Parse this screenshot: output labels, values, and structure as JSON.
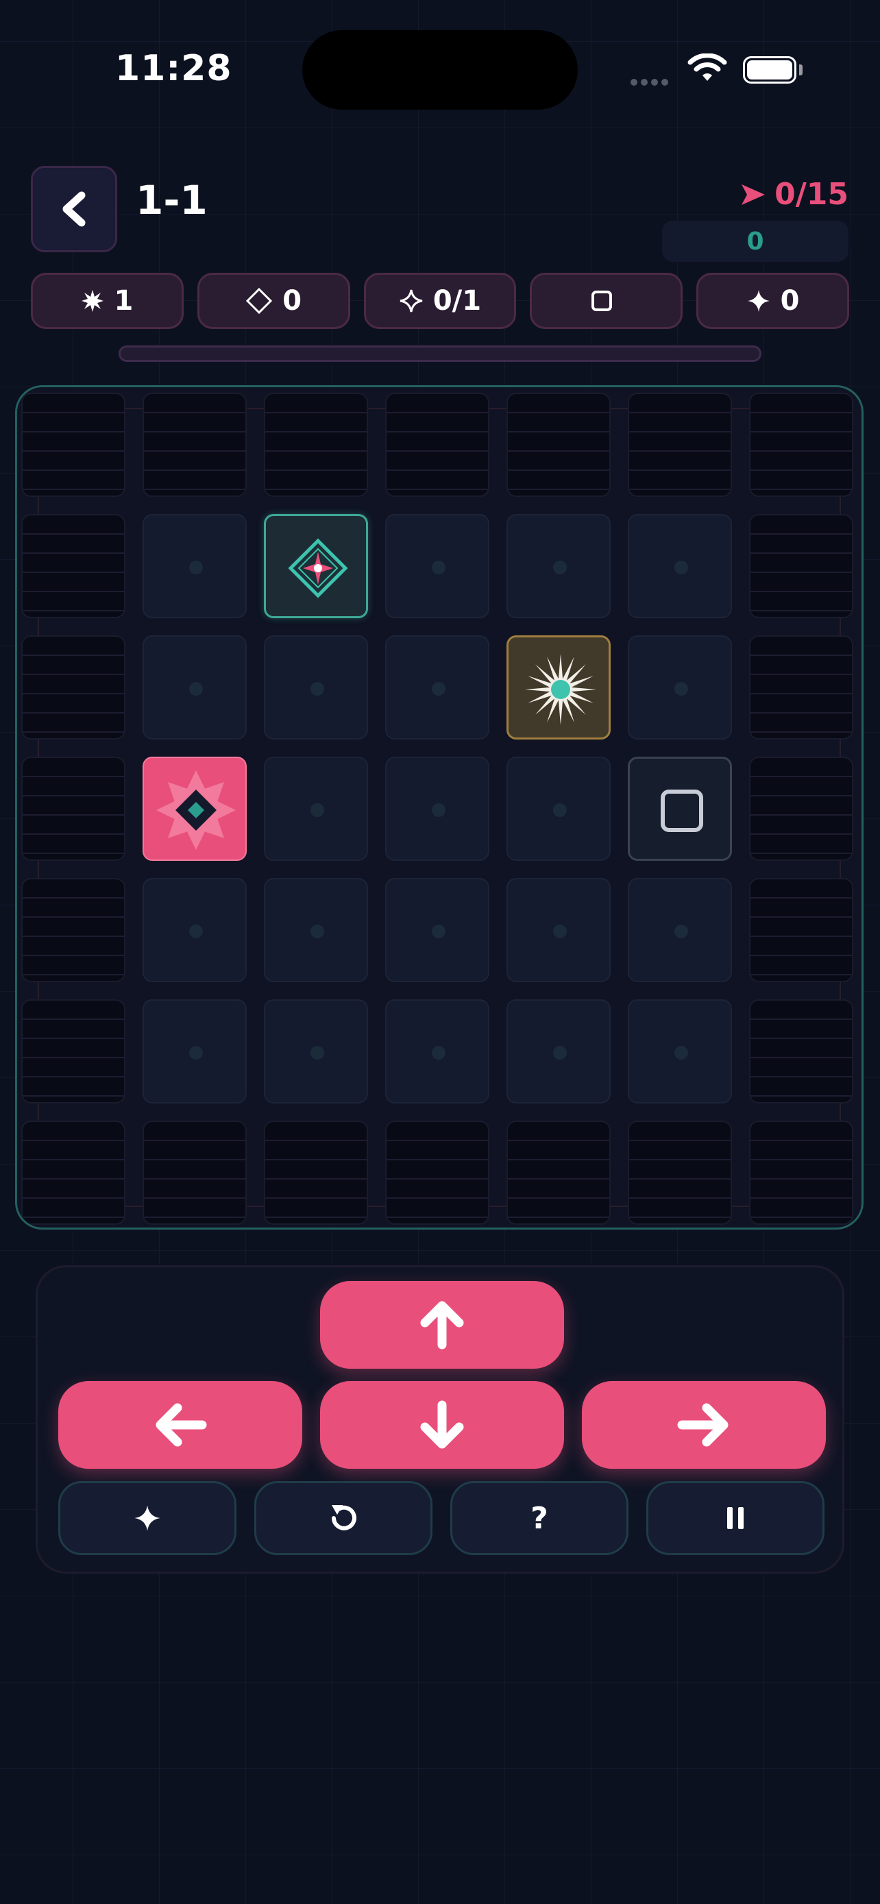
{
  "status_bar": {
    "time": "11:28"
  },
  "header": {
    "level": "1-1",
    "moves": "0/15",
    "score": "0"
  },
  "counters": [
    {
      "icon": "burst-icon",
      "value": "1"
    },
    {
      "icon": "diamond-outline-icon",
      "value": "0"
    },
    {
      "icon": "sparkle-outline-icon",
      "value": "0/1"
    },
    {
      "icon": "square-outline-icon",
      "value": ""
    },
    {
      "icon": "sparkle-solid-icon",
      "value": "0"
    }
  ],
  "progress": 0,
  "board": {
    "cols": 7,
    "rows": 7,
    "tiles": [
      {
        "row": 1,
        "col": 2,
        "type": "goal"
      },
      {
        "row": 2,
        "col": 4,
        "type": "star"
      },
      {
        "row": 3,
        "col": 1,
        "type": "player"
      },
      {
        "row": 3,
        "col": 5,
        "type": "block"
      }
    ]
  },
  "controls": {
    "arrows": [
      "up",
      "left",
      "down",
      "right"
    ],
    "tools": [
      {
        "name": "hint-button",
        "icon": "sparkle-solid-icon",
        "label": "✦"
      },
      {
        "name": "restart-button",
        "icon": "restart-icon",
        "label": ""
      },
      {
        "name": "help-button",
        "icon": "question-icon",
        "label": "?"
      },
      {
        "name": "pause-button",
        "icon": "pause-icon",
        "label": ""
      }
    ]
  },
  "colors": {
    "accent": "#e94f7b",
    "teal": "#2a9d8f",
    "gold": "#a17d3f",
    "background": "#0c1120"
  }
}
